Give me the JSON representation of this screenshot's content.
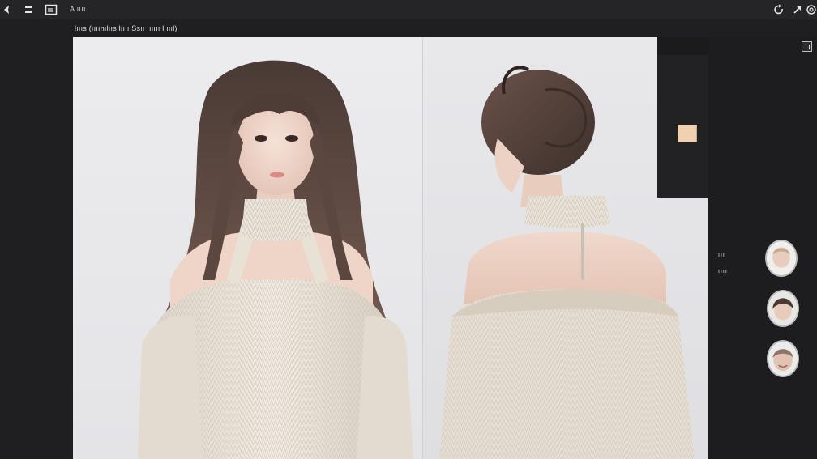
{
  "toolbar": {
    "title": "A ıııı",
    "back_icon": "back-arrow-icon",
    "menu_icon": "menu-icon",
    "image_icon": "image-icon",
    "refresh_icon": "refresh-icon",
    "share_icon": "share-icon",
    "spiral_icon": "spiral-icon"
  },
  "subbar": {
    "caption": "lıııs (ıııınılııs lıııı Ssıı ıııııı lııııl)"
  },
  "palette": {
    "swatch_color": "#efd1b1"
  },
  "sidebar": {
    "label_1": "ııı",
    "label_2": "ıııı",
    "avatars": [
      "avatar-1",
      "avatar-2",
      "avatar-3"
    ]
  },
  "colors": {
    "background": "#1c1c1e",
    "canvas": "#e9e9ec",
    "sweater": "#ece6dc",
    "hair": "#5a4640",
    "skin": "#f0d8cc"
  }
}
